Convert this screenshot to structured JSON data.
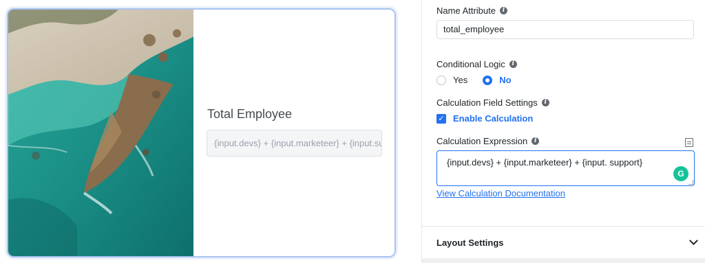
{
  "preview": {
    "field_label": "Total Employee",
    "field_placeholder": "{input.devs} + {input.marketeer} + {input.support}"
  },
  "settings": {
    "name_attribute": {
      "label": "Name Attribute",
      "value": "total_employee"
    },
    "conditional_logic": {
      "label": "Conditional Logic",
      "options": [
        "Yes",
        "No"
      ],
      "selected": "No"
    },
    "calculation_field_settings": {
      "label": "Calculation Field Settings",
      "checkbox_label": "Enable Calculation",
      "checked": true
    },
    "calculation_expression": {
      "label": "Calculation Expression",
      "value": "{input.devs} + {input.marketeer} + {input. support}"
    },
    "doc_link": "View Calculation Documentation",
    "layout_settings": {
      "title": "Layout Settings"
    }
  },
  "icons": {
    "info": "info-icon",
    "docs": "document-icon",
    "grammarly": "grammarly-icon",
    "chevron": "chevron-down-icon"
  },
  "colors": {
    "accent": "#2271f0",
    "grammarly": "#15c39a",
    "card_border": "#a8c3f0"
  }
}
